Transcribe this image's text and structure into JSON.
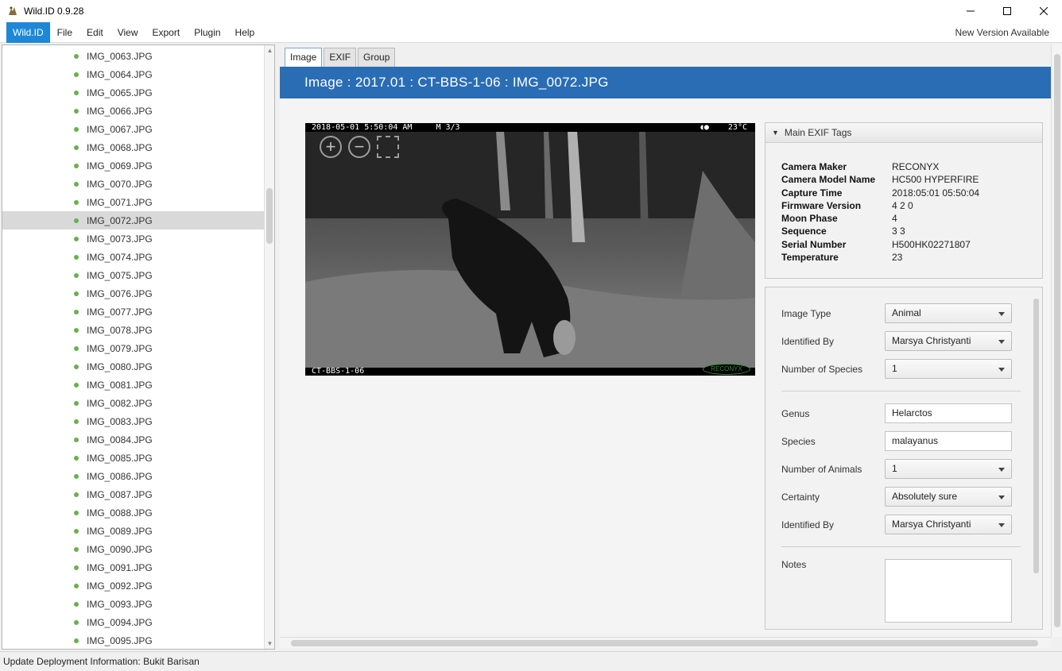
{
  "window": {
    "title": "Wild.ID 0.9.28",
    "controls": [
      "minimize",
      "maximize",
      "close"
    ]
  },
  "menu": {
    "brand": "Wild.ID",
    "items": [
      "File",
      "Edit",
      "View",
      "Export",
      "Plugin",
      "Help"
    ],
    "new_version": "New Version Available"
  },
  "tree": {
    "items": [
      "IMG_0063.JPG",
      "IMG_0064.JPG",
      "IMG_0065.JPG",
      "IMG_0066.JPG",
      "IMG_0067.JPG",
      "IMG_0068.JPG",
      "IMG_0069.JPG",
      "IMG_0070.JPG",
      "IMG_0071.JPG",
      "IMG_0072.JPG",
      "IMG_0073.JPG",
      "IMG_0074.JPG",
      "IMG_0075.JPG",
      "IMG_0076.JPG",
      "IMG_0077.JPG",
      "IMG_0078.JPG",
      "IMG_0079.JPG",
      "IMG_0080.JPG",
      "IMG_0081.JPG",
      "IMG_0082.JPG",
      "IMG_0083.JPG",
      "IMG_0084.JPG",
      "IMG_0085.JPG",
      "IMG_0086.JPG",
      "IMG_0087.JPG",
      "IMG_0088.JPG",
      "IMG_0089.JPG",
      "IMG_0090.JPG",
      "IMG_0091.JPG",
      "IMG_0092.JPG",
      "IMG_0093.JPG",
      "IMG_0094.JPG",
      "IMG_0095.JPG"
    ],
    "selected": "IMG_0072.JPG",
    "status_color": "#6ab04c"
  },
  "tabs": [
    "Image",
    "EXIF",
    "Group"
  ],
  "active_tab": "Image",
  "header": {
    "title": "Image : 2017.01 : CT-BBS-1-06 : IMG_0072.JPG",
    "color": "#2a6db5"
  },
  "photo": {
    "timestamp": "2018-05-01 5:50:04 AM",
    "sequence": "M 3/3",
    "moon_icon": "moon-phase-icon",
    "temperature": "23°C",
    "camera_label": "CT-BBS-1-06",
    "logo": "RECONYX"
  },
  "exif": {
    "title": "Main EXIF Tags",
    "rows": [
      {
        "key": "Camera Maker",
        "value": "RECONYX"
      },
      {
        "key": "Camera Model Name",
        "value": "HC500 HYPERFIRE"
      },
      {
        "key": "Capture Time",
        "value": "2018:05:01 05:50:04"
      },
      {
        "key": "Firmware Version",
        "value": "4 2 0"
      },
      {
        "key": "Moon Phase",
        "value": "4"
      },
      {
        "key": "Sequence",
        "value": "3 3"
      },
      {
        "key": "Serial Number",
        "value": "H500HK02271807"
      },
      {
        "key": "Temperature",
        "value": "23"
      }
    ]
  },
  "form": {
    "image_type": {
      "label": "Image Type",
      "value": "Animal"
    },
    "identified_by_1": {
      "label": "Identified By",
      "value": "Marsya Christyanti"
    },
    "number_of_species": {
      "label": "Number of Species",
      "value": "1"
    },
    "genus": {
      "label": "Genus",
      "value": "Helarctos"
    },
    "species": {
      "label": "Species",
      "value": "malayanus"
    },
    "number_of_animals": {
      "label": "Number of Animals",
      "value": "1"
    },
    "certainty": {
      "label": "Certainty",
      "value": "Absolutely sure"
    },
    "identified_by_2": {
      "label": "Identified By",
      "value": "Marsya Christyanti"
    },
    "notes": {
      "label": "Notes",
      "value": ""
    }
  },
  "status": "Update Deployment Information: Bukit Barisan"
}
